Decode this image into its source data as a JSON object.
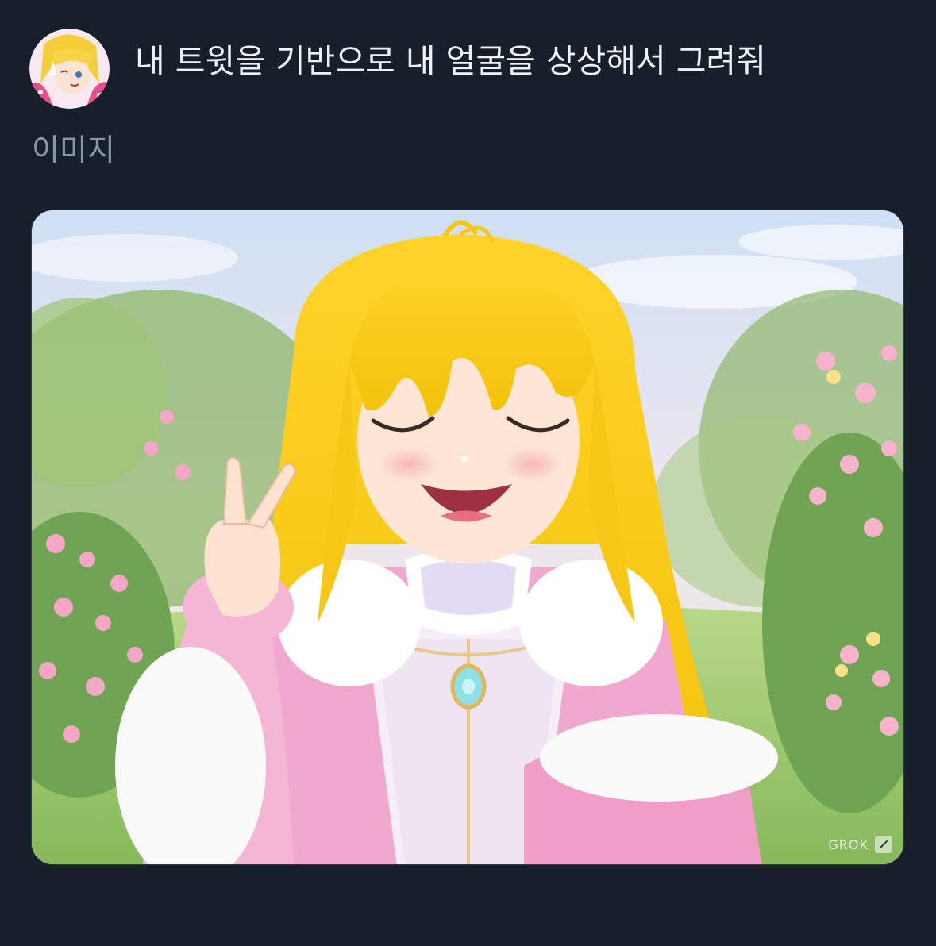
{
  "post": {
    "avatar_icon": "user-avatar-anime",
    "prompt_text": "내 트윗을 기반으로 내 얼굴을 상상해서 그려줘",
    "section_label": "이미지"
  },
  "image": {
    "subject": "anime-girl-blonde-peace-sign",
    "watermark_text": "GROK",
    "edit_icon": "edit-pencil-icon"
  },
  "colors": {
    "background": "#161f2a",
    "text_primary": "#eef2f6",
    "text_secondary": "#8a96a3"
  }
}
